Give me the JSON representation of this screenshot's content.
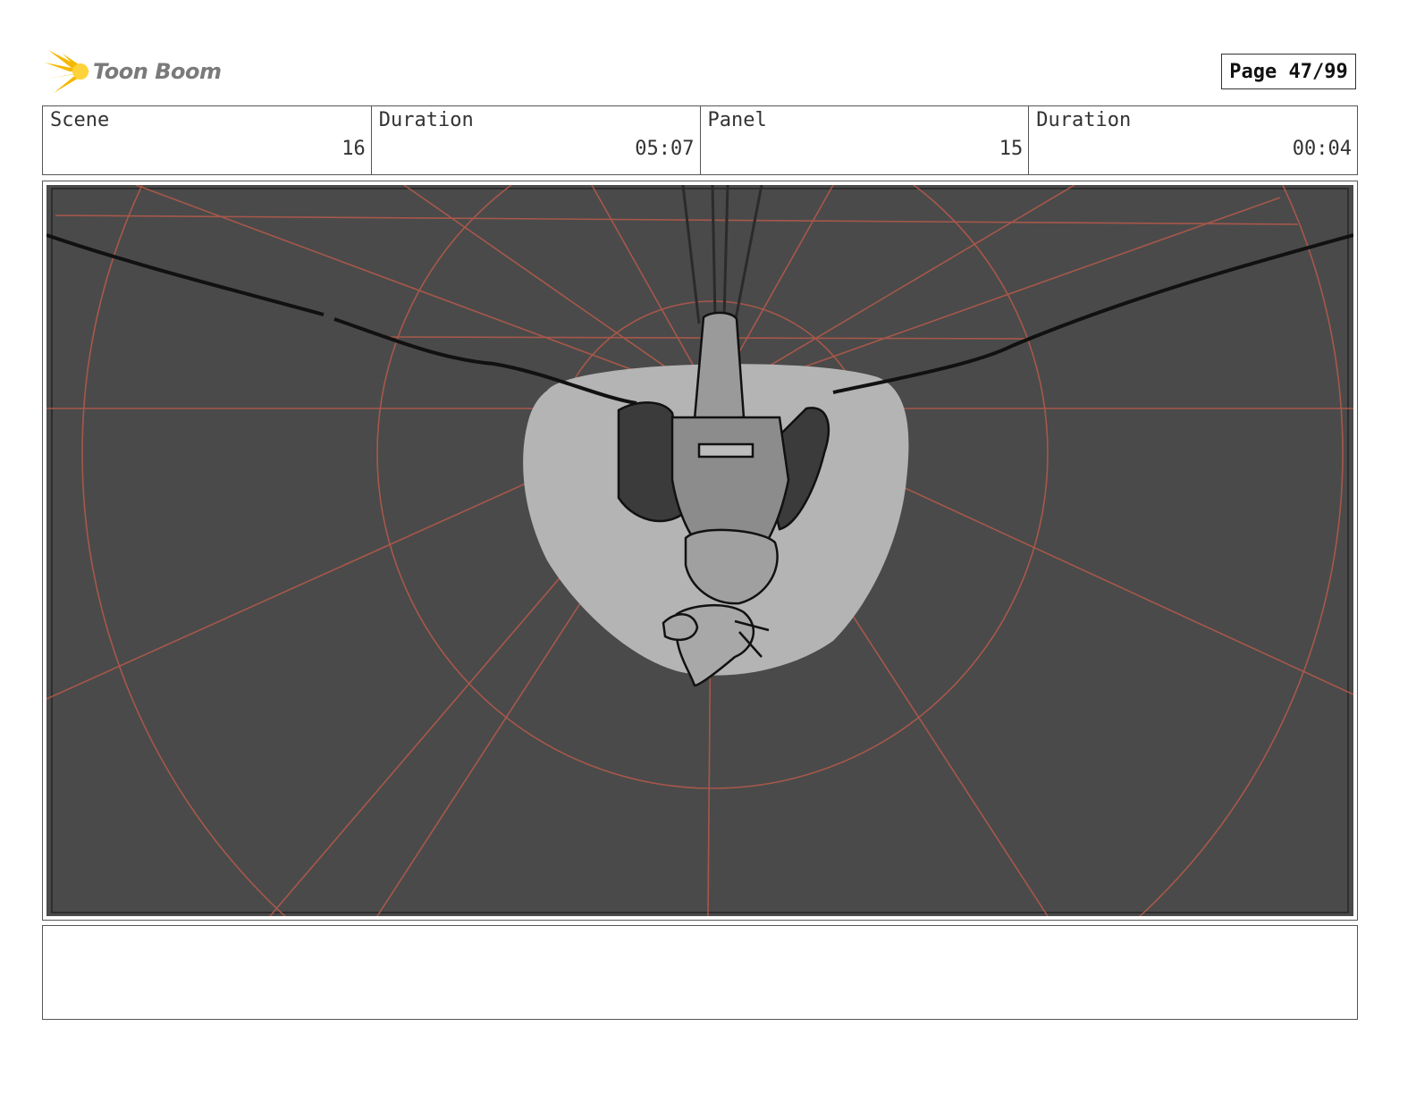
{
  "header": {
    "logo_text": "Toon Boom",
    "page_label": "Page",
    "page_number": "47/99"
  },
  "info": [
    {
      "label": "Scene",
      "value": "16"
    },
    {
      "label": "Duration",
      "value": "05:07"
    },
    {
      "label": "Panel",
      "value": "15"
    },
    {
      "label": "Duration",
      "value": "00:04"
    }
  ],
  "colors": {
    "panel_background": "#4a4a4a",
    "perspective_guides": "#b85a4a",
    "spotlight": "#b4b4b4",
    "logo_accent": "#f5b800"
  },
  "notes": {
    "text": ""
  }
}
